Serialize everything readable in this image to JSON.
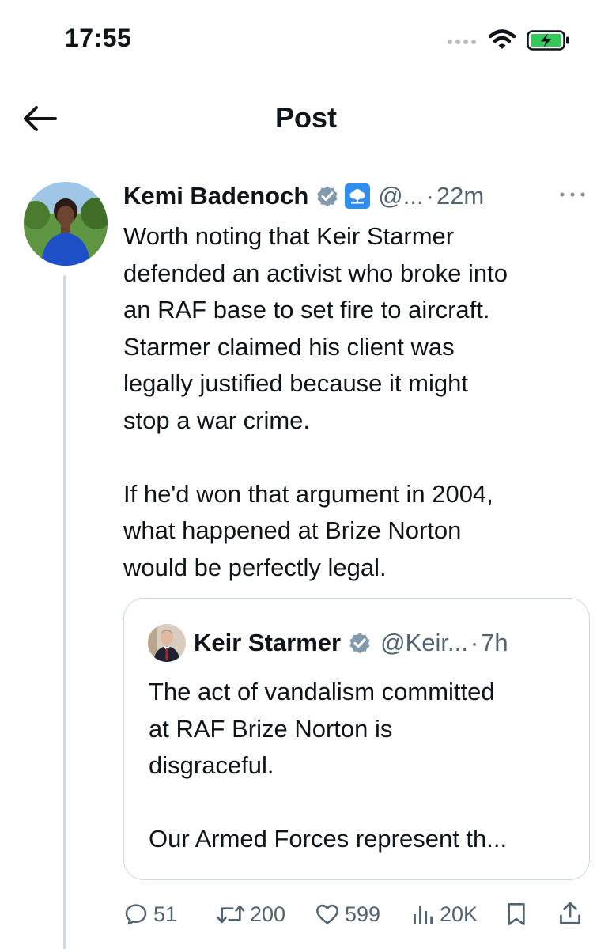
{
  "status_bar": {
    "time": "17:55"
  },
  "header": {
    "title": "Post"
  },
  "tweet": {
    "author_name": "Kemi Badenoch",
    "handle": "@...",
    "separator": "·",
    "time": "22m",
    "text": "Worth noting that Keir Starmer\ndefended an activist who broke into\nan RAF base to set fire to aircraft.\nStarmer claimed his client was\nlegally justified because it might\nstop a war crime.\n\nIf he'd won that argument in 2004,\nwhat happened at Brize Norton\nwould be perfectly legal.",
    "quoted": {
      "author_name": "Keir Starmer",
      "handle": "@Keir...",
      "separator": "·",
      "time": "7h",
      "text": "The act of vandalism committed\nat RAF Brize Norton is\ndisgraceful.\n\nOur Armed Forces represent th..."
    },
    "metrics": {
      "replies": "51",
      "reposts": "200",
      "likes": "599",
      "views": "20K"
    }
  },
  "colors": {
    "verified": "#829aab",
    "affiliation_badge": "#2f8ef0",
    "secondary_text": "#536471",
    "border": "#cfd9de",
    "battery_green": "#34c759"
  },
  "icons": [
    "back-arrow-icon",
    "verified-icon",
    "tree-icon",
    "more-icon",
    "reply-icon",
    "repost-icon",
    "like-icon",
    "views-icon",
    "bookmark-icon",
    "share-icon",
    "wifi-icon",
    "battery-charging-icon"
  ]
}
